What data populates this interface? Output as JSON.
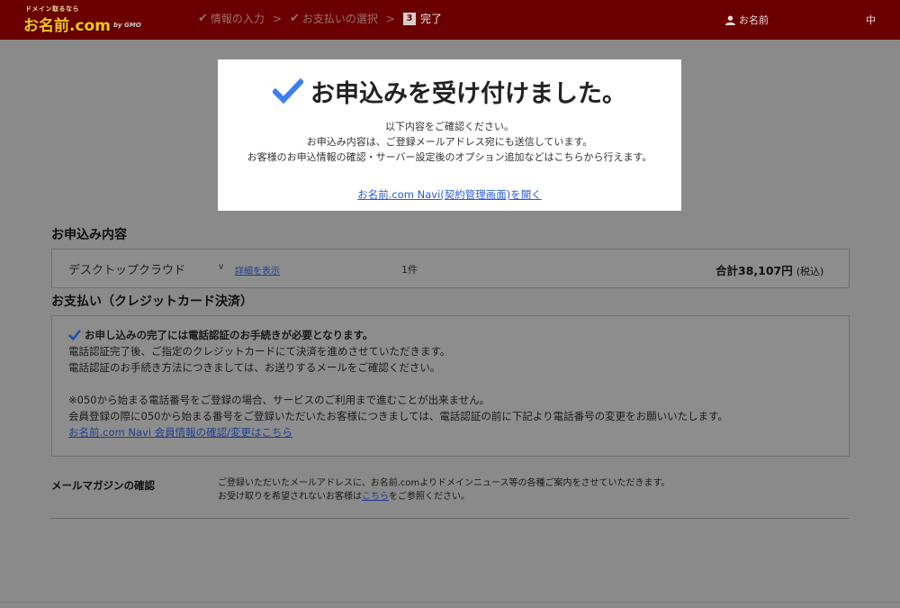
{
  "header": {
    "logo": {
      "tagline": "ドメイン取るなら",
      "main": "お名前.com",
      "sub": "by GMO",
      "gmo": "by GMO"
    },
    "steps": [
      {
        "label": "情報の入力",
        "state": "done"
      },
      {
        "label": "お支払いの選択",
        "state": "done"
      },
      {
        "number": "3",
        "label": "完了",
        "state": "current"
      }
    ],
    "user_label": "お名前",
    "lang_label": "中",
    "colors": {
      "bar": "#6b0000",
      "logo": "#f5c518"
    }
  },
  "modal": {
    "title": "お申込みを受け付けました。",
    "lines": [
      "以下内容をご確認ください。",
      "お申込み内容は、ご登録メールアドレス宛にも送信しています。",
      "お客様のお申込情報の確認・サーバー設定後のオプション追加などはこちらから行えます。"
    ],
    "link": "お名前.com Navi(契約管理画面)を開く",
    "check_color": "#3a7ff0"
  },
  "order": {
    "section_title": "お申込み内容",
    "product": "デスクトップクラウド",
    "detail_link": "詳細を表示",
    "quantity": "1件",
    "total": "合計38,107円",
    "tax": "(税込)"
  },
  "payment": {
    "section_title": "お支払い（クレジットカード決済）",
    "headline": "お申し込みの完了には電話認証のお手続きが必要となります。",
    "lines": [
      "電話認証完了後、ご指定のクレジットカードにて決済を進めさせていただきます。",
      "電話認証のお手続き方法につきましては、お送りするメールをご確認ください。"
    ],
    "notes": [
      "※050から始まる電話番号をご登録の場合、サービスのご利用まで進むことが出来ません。",
      "会員登録の際に050から始まる番号をご登録いただいたお客様につきましては、電話認証の前に下記より電話番号の変更をお願いいたします。"
    ],
    "link": "お名前.com Navi 会員情報の確認/変更はこちら"
  },
  "mail_magazine": {
    "label": "メールマガジンの確認",
    "line1": "ご登録いただいたメールアドレスに、お名前.comよりドメインニュース等の各種ご案内をさせていただきます。",
    "line2_before": "お受け取りを希望されないお客様は",
    "line2_link": "こちら",
    "line2_after": "をご参照ください。"
  }
}
